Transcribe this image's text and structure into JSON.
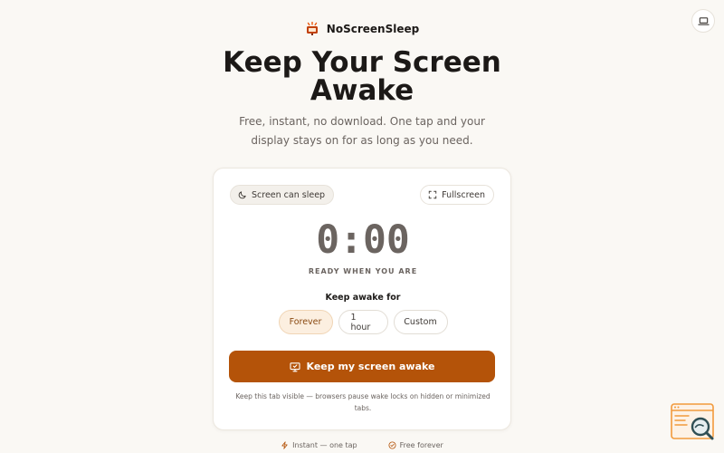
{
  "brand": {
    "name": "NoScreenSleep",
    "logo_icon": "monitor-sun-icon",
    "accent_color": "#b45309"
  },
  "header": {
    "top_right_icon": "laptop-icon"
  },
  "hero": {
    "title_line1": "Keep Your Screen",
    "title_line2": "Awake",
    "subtitle_line1": "Free, instant, no download. One tap and your",
    "subtitle_line2": "display stays on for as long as you need."
  },
  "card": {
    "status_label": "Screen can sleep",
    "status_icon": "moon-icon",
    "fullscreen_label": "Fullscreen",
    "fullscreen_icon": "expand-icon",
    "timer_value": "0:00",
    "timer_caption": "READY WHEN YOU ARE",
    "duration_label": "Keep awake for",
    "duration_options": [
      {
        "label": "Forever",
        "selected": true
      },
      {
        "label": "1 hour",
        "selected": false
      },
      {
        "label": "Custom",
        "selected": false
      }
    ],
    "cta_label": "Keep my screen awake",
    "cta_icon": "monitor-icon",
    "note_line1": "Keep this tab visible — browsers pause wake locks on hidden or minimized",
    "note_line2": "tabs."
  },
  "features": [
    {
      "icon": "lightning-icon",
      "label": "Instant — one tap"
    },
    {
      "icon": "check-circle-icon",
      "label": "Free forever"
    }
  ]
}
